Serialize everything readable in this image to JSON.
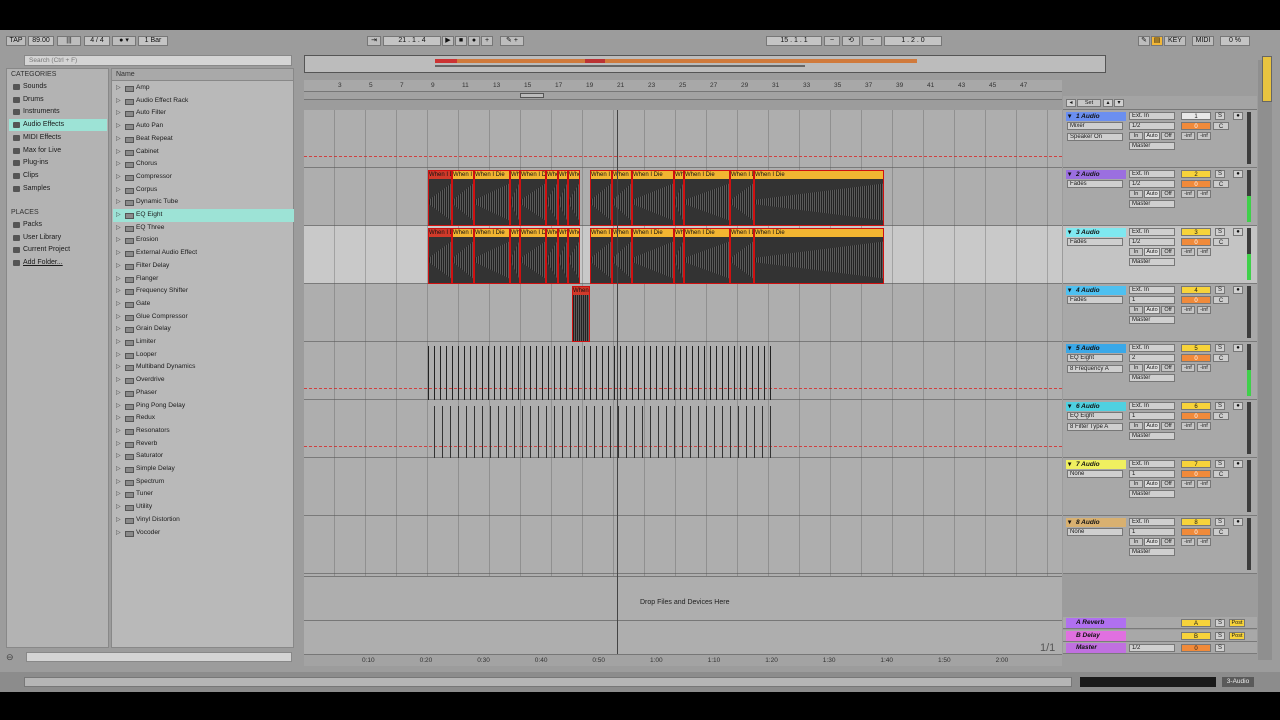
{
  "transport": {
    "tap": "TAP",
    "tempo": "89.00",
    "meter": "4 / 4",
    "quantize": "1 Bar",
    "position": "21 . 1 . 4",
    "loop_start": "15 . 1 . 1",
    "loop_length": "1 . 2 . 0",
    "key": "KEY",
    "midi": "MIDI",
    "cpu": "0 %"
  },
  "browser": {
    "search_placeholder": "Search (Ctrl + F)",
    "categories_header": "CATEGORIES",
    "categories": [
      "Sounds",
      "Drums",
      "Instruments",
      "Audio Effects",
      "MIDI Effects",
      "Max for Live",
      "Plug-ins",
      "Clips",
      "Samples"
    ],
    "places_header": "PLACES",
    "places": [
      "Packs",
      "User Library",
      "Current Project",
      "Add Folder..."
    ],
    "name_header": "Name",
    "items": [
      "Amp",
      "Audio Effect Rack",
      "Auto Filter",
      "Auto Pan",
      "Beat Repeat",
      "Cabinet",
      "Chorus",
      "Compressor",
      "Corpus",
      "Dynamic Tube",
      "EQ Eight",
      "EQ Three",
      "Erosion",
      "External Audio Effect",
      "Filter Delay",
      "Flanger",
      "Frequency Shifter",
      "Gate",
      "Glue Compressor",
      "Grain Delay",
      "Limiter",
      "Looper",
      "Multiband Dynamics",
      "Overdrive",
      "Phaser",
      "Ping Pong Delay",
      "Redux",
      "Resonators",
      "Reverb",
      "Saturator",
      "Simple Delay",
      "Spectrum",
      "Tuner",
      "Utility",
      "Vinyl Distortion",
      "Vocoder"
    ],
    "selected_item": "EQ Eight",
    "selected_category": "Audio Effects"
  },
  "ruler": {
    "bars": [
      "3",
      "5",
      "7",
      "9",
      "11",
      "13",
      "15",
      "17",
      "19",
      "21",
      "23",
      "25",
      "27",
      "29",
      "31",
      "33",
      "35",
      "37",
      "39",
      "41",
      "43",
      "45",
      "47"
    ],
    "time": [
      "0:10",
      "0:20",
      "0:30",
      "0:40",
      "0:50",
      "1:00",
      "1:10",
      "1:20",
      "1:30",
      "1:40",
      "1:50",
      "2:00"
    ]
  },
  "tracks": [
    {
      "name": "1 Audio",
      "color": "#6b8ff0",
      "dev1": "Mixer",
      "dev2": "Speaker On",
      "input": "Ext. In",
      "ch": "1/2",
      "out": "Master",
      "num": "1",
      "numcolor": "#e8e8e8",
      "vol": "0",
      "pan": "C"
    },
    {
      "name": "2 Audio",
      "color": "#9b6fe0",
      "dev1": "Fades",
      "dev2": "",
      "input": "Ext. In",
      "ch": "1/2",
      "out": "Master",
      "num": "2",
      "numcolor": "#f7d33a",
      "vol": "0",
      "pan": "C"
    },
    {
      "name": "3 Audio",
      "color": "#7fe8f0",
      "dev1": "Fades",
      "dev2": "",
      "input": "Ext. In",
      "ch": "1/2",
      "out": "Master",
      "num": "3",
      "numcolor": "#f7d33a",
      "vol": "0",
      "pan": "C"
    },
    {
      "name": "4 Audio",
      "color": "#4ec0f0",
      "dev1": "Fades",
      "dev2": "",
      "input": "Ext. In",
      "ch": "1",
      "out": "Master",
      "num": "4",
      "numcolor": "#f7d33a",
      "vol": "0",
      "pan": "C"
    },
    {
      "name": "5 Audio",
      "color": "#3aa8e8",
      "dev1": "EQ Eight",
      "dev2": "8 Frequency A",
      "input": "Ext. In",
      "ch": "2",
      "out": "Master",
      "num": "5",
      "numcolor": "#f7d33a",
      "vol": "0",
      "pan": "C"
    },
    {
      "name": "6 Audio",
      "color": "#4fd0e0",
      "dev1": "EQ Eight",
      "dev2": "8 Filter Type A",
      "input": "Ext. In",
      "ch": "1",
      "out": "Master",
      "num": "6",
      "numcolor": "#f7d33a",
      "vol": "0",
      "pan": "C"
    },
    {
      "name": "7 Audio",
      "color": "#f0f060",
      "dev1": "None",
      "dev2": "",
      "input": "Ext. In",
      "ch": "1",
      "out": "Master",
      "num": "7",
      "numcolor": "#f7d33a",
      "vol": "0",
      "pan": "C"
    },
    {
      "name": "8 Audio",
      "color": "#d8b070",
      "dev1": "None",
      "dev2": "",
      "input": "Ext. In",
      "ch": "1",
      "out": "Master",
      "num": "8",
      "numcolor": "#f7d33a",
      "vol": "0",
      "pan": "C"
    }
  ],
  "returns": [
    {
      "name": "A Reverb",
      "color": "#b070f0",
      "letter": "A"
    },
    {
      "name": "B Delay",
      "color": "#e070e0",
      "letter": "B"
    },
    {
      "name": "Master",
      "color": "#c070e0",
      "letter": "0"
    }
  ],
  "io": {
    "in": "In",
    "auto": "Auto",
    "off": "Off",
    "inf": "-inf",
    "solo": "S",
    "post": "Post",
    "master_out": "1/2",
    "set": "Set"
  },
  "clip_label": "When I Die",
  "clip_short": [
    "When",
    "When I",
    "When I Die",
    "Wh",
    "When",
    "W",
    "Whe"
  ],
  "drop_text": "Drop Files and Devices Here",
  "page_counter": "1/1",
  "status": {
    "track": "3-Audio"
  }
}
